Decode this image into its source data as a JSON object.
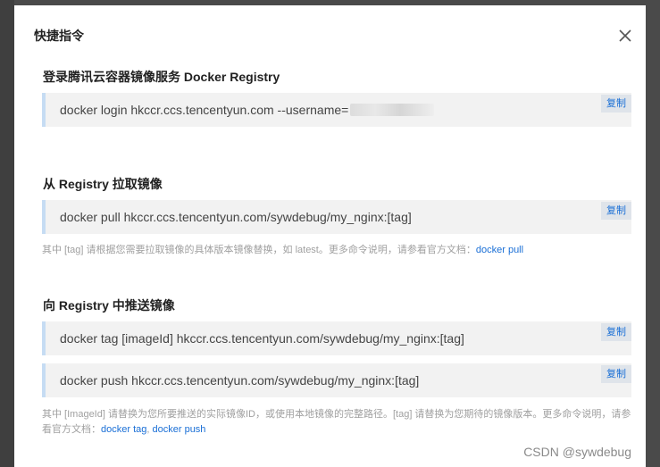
{
  "dialog": {
    "title": "快捷指令",
    "close_icon": "close-icon"
  },
  "sections": [
    {
      "title": "登录腾讯云容器镜像服务 Docker Registry",
      "commands": [
        {
          "text": "docker login hkccr.ccs.tencentyun.com --username=",
          "copy_label": "复制"
        }
      ]
    },
    {
      "title": "从 Registry 拉取镜像",
      "commands": [
        {
          "text": "docker pull hkccr.ccs.tencentyun.com/sywdebug/my_nginx:[tag]",
          "copy_label": "复制"
        }
      ],
      "note": {
        "text": "其中 [tag] 请根据您需要拉取镜像的具体版本镜像替换，如 latest。更多命令说明，请参看官方文档：",
        "links": [
          "docker pull"
        ]
      }
    },
    {
      "title": "向 Registry 中推送镜像",
      "commands": [
        {
          "text": "docker tag [imageId] hkccr.ccs.tencentyun.com/sywdebug/my_nginx:[tag]",
          "copy_label": "复制"
        },
        {
          "text": "docker push hkccr.ccs.tencentyun.com/sywdebug/my_nginx:[tag]",
          "copy_label": "复制"
        }
      ],
      "note": {
        "text": "其中 [ImageId] 请替换为您所要推送的实际镜像ID，或使用本地镜像的完整路径。[tag] 请替换为您期待的镜像版本。更多命令说明，请参看官方文档：",
        "links": [
          "docker tag",
          "docker push"
        ],
        "separator": ", "
      }
    }
  ],
  "watermark": "CSDN @sywdebug"
}
